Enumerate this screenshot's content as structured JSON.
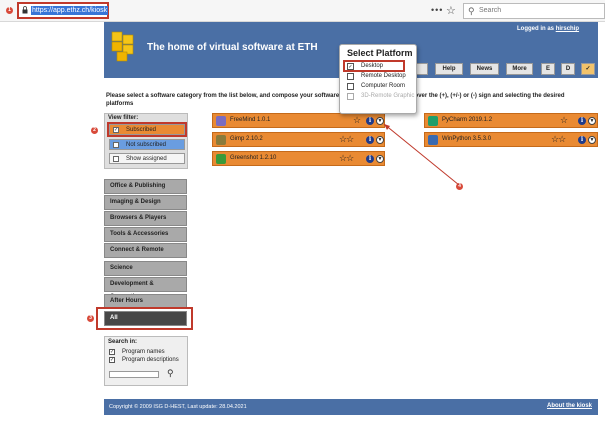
{
  "browser": {
    "url": "https://app.ethz.ch/kiosk",
    "more_icon": "ellipsis-icon",
    "bookmark_icon": "star-icon",
    "search_placeholder": "Search"
  },
  "markers": [
    "1",
    "2",
    "3",
    "4",
    "5"
  ],
  "header": {
    "title": "The home of virtual software at ETH",
    "logged_prefix": "Logged in as",
    "username": "hirschip",
    "buttons": [
      "Help",
      "News",
      "More",
      "E",
      "D"
    ]
  },
  "intro_text_left": "Please select a software category from the list below, and compose your software",
  "intro_text_right": "use over the (+), (+/-) or (-) sign and selecting the desired",
  "intro_text_line2": "platforms",
  "view_filter": {
    "title": "View filter:",
    "options": [
      {
        "label": "Subscribed",
        "checked": true
      },
      {
        "label": "Not subscribed",
        "checked": false
      },
      {
        "label": "Show assigned",
        "checked": false
      }
    ]
  },
  "categories": [
    "Office & Publishing",
    "Imaging & Design",
    "Browsers & Players",
    "Tools & Accessories",
    "Connect & Remote",
    "Science",
    "Development & Computing",
    "After Hours",
    "All"
  ],
  "search_in": {
    "title": "Search in:",
    "options": [
      {
        "label": "Program names",
        "checked": true
      },
      {
        "label": "Program descriptions",
        "checked": true
      }
    ]
  },
  "software": [
    {
      "name": "FreeMind 1.0.1",
      "rating": "☆",
      "color": "#7a6cc0"
    },
    {
      "name": "Gimp 2.10.2",
      "rating": "☆☆",
      "color": "#8a7a3a"
    },
    {
      "name": "Greenshot 1.2.10",
      "rating": "☆☆",
      "color": "#3a9a3a"
    },
    {
      "name": "PyCharm 2019.1.2",
      "rating": "☆",
      "color": "#1f9e6a"
    },
    {
      "name": "WinPython 3.5.3.0",
      "rating": "☆☆",
      "color": "#3a6ab0"
    }
  ],
  "popup": {
    "title": "Select Platform",
    "options": [
      {
        "label": "Desktop",
        "checked": true,
        "disabled": false
      },
      {
        "label": "Remote Desktop",
        "checked": false,
        "disabled": false
      },
      {
        "label": "Computer Room",
        "checked": false,
        "disabled": false
      },
      {
        "label": "3D-Remote Graphic",
        "checked": false,
        "disabled": true
      }
    ]
  },
  "footer": {
    "copyright": "Copyright © 2009 ISG D-HEST, Last update: 28.04.2021",
    "about": "About the kiosk"
  },
  "colors": {
    "header": "#4a6fa5",
    "tile": "#e98a33",
    "highlight": "#c0392b"
  }
}
